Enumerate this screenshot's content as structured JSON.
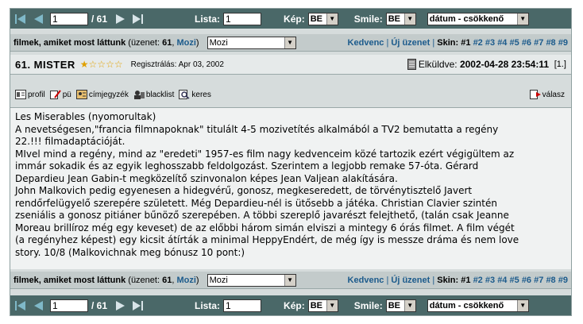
{
  "nav": {
    "page": "1",
    "total": "/ 61",
    "lista_label": "Lista:",
    "lista_value": "1",
    "kep_label": "Kép:",
    "kep_value": "BE",
    "smile_label": "Smile:",
    "smile_value": "BE",
    "sort_value": "dátum - csökkenő"
  },
  "topic": {
    "title": "filmek, amiket most láttunk",
    "count_prefix": "(üzenet:",
    "count": "61",
    "count_sep": ",",
    "mozi_link": "Mozi",
    "count_suffix": ")",
    "select_value": "Mozi",
    "kedvenc": "Kedvenc",
    "sep": "|",
    "uj_uzenet": "Új üzenet",
    "skin_label": "Skin:",
    "skins": [
      "#1",
      "#2",
      "#3",
      "#4",
      "#5",
      "#6",
      "#7",
      "#8",
      "#9"
    ]
  },
  "post": {
    "author": "61. MISTER",
    "stars": "★☆☆☆☆",
    "registered": "Regisztrálás: Apr 03, 2002",
    "sent_label": "Elküldve:",
    "sent_date": "2002-04-28 23:54:11",
    "index": "[1.]",
    "tools": {
      "profil": "profil",
      "pu": "pü",
      "cimjegyzek": "címjegyzék",
      "blacklist": "blacklist",
      "keres": "keres",
      "valasz": "válasz"
    },
    "lines": [
      "Les Miserables (nyomorultak)",
      "A nevetségesen,\"francia filmnapoknak\" titulált 4-5 mozivetítés alkalmából a TV2 bemutatta a regény",
      "22.!!! filmadaptációját.",
      "MIvel mind a regény, mind az \"eredeti\" 1957-es film nagy kedvenceim közé tartozik ezért végigültem az",
      "immár sokadik és az egyik leghosszabb feldolgozást. Szerintem a legjobb remake 57-óta. Gérard",
      "Depardieu Jean Gabin-t megközelítő szinvonalon képes Jean Valjean alakítására.",
      "John Malkovich pedig egyenesen a hidegvérű, gonosz, megkeseredett, de törvénytisztelő Javert",
      "rendőrfelügyelő szerepére született. Még Depardieu-nél is ütősebb a játéka. Christian Clavier szintén",
      "zseniális a gonosz pitiáner bűnöző szerepében. A többi szereplő javarészt felejthető, (talán csak Jeanne",
      "Moreau brillíroz még egy keveset) de az előbbi három simán elviszi a mintegy 6 órás filmet. A film végét",
      "(a regényhez képest) egy kicsit átírták a minimal HeppyEndért, de még így is messze dráma és nem love",
      "story. 10/8 (Malkovichnak meg bónusz 10 pont:)"
    ]
  }
}
